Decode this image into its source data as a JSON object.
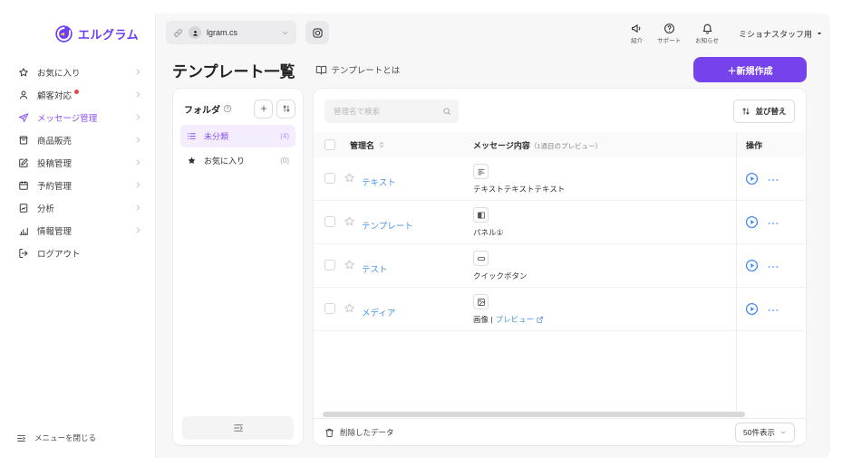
{
  "brand": {
    "logo_text": "エルグラム",
    "brand_color": "#6C3BF5"
  },
  "topbar": {
    "account_value": "lgram.cs",
    "account_icons": [
      "link-icon",
      "avatar-icon",
      "chevron-down-icon"
    ],
    "instagram_icon": "instagram-icon",
    "actions": [
      {
        "label": "紹介",
        "icon": "megaphone"
      },
      {
        "label": "サポート",
        "icon": "help-circle"
      },
      {
        "label": "お知らせ",
        "icon": "bell"
      }
    ],
    "user_menu_label": "ミショナスタッフ用"
  },
  "sidebar": {
    "items": [
      {
        "label": "お気に入り",
        "icon": "star-outline",
        "chevron": true,
        "active": false,
        "dot": false
      },
      {
        "label": "顧客対応",
        "icon": "person",
        "chevron": true,
        "active": false,
        "dot": true
      },
      {
        "label": "メッセージ管理",
        "icon": "send",
        "chevron": true,
        "active": true,
        "dot": false
      },
      {
        "label": "商品販売",
        "icon": "shop",
        "chevron": true,
        "active": false,
        "dot": false
      },
      {
        "label": "投稿管理",
        "icon": "edit",
        "chevron": true,
        "active": false,
        "dot": false
      },
      {
        "label": "予約管理",
        "icon": "calendar",
        "chevron": true,
        "active": false,
        "dot": false
      },
      {
        "label": "分析",
        "icon": "analytics",
        "chevron": true,
        "active": false,
        "dot": false
      },
      {
        "label": "情報管理",
        "icon": "chart",
        "chevron": true,
        "active": false,
        "dot": false
      },
      {
        "label": "ログアウト",
        "icon": "logout",
        "chevron": false,
        "active": false,
        "dot": false
      }
    ],
    "close_menu_label": "メニューを閉じる"
  },
  "page": {
    "title": "テンプレート一覧",
    "help_link": "テンプレートとは",
    "create_button_label": "＋新規作成"
  },
  "folders": {
    "title": "フォルダ",
    "items": [
      {
        "label": "未分類",
        "count": "(4)",
        "icon": "list",
        "active": true
      },
      {
        "label": "お気に入り",
        "count": "(0)",
        "icon": "star-filled",
        "active": false
      }
    ]
  },
  "table": {
    "search_placeholder": "管理名で検索",
    "sort_button_label": "並び替え",
    "columns": {
      "name": "管理名",
      "content": "メッセージ内容",
      "content_note": "（1通目のプレビュー）",
      "actions": "操作"
    },
    "rows": [
      {
        "name": "テキスト",
        "type_icon": "text-lines",
        "content": "テキストテキストテキスト",
        "link": ""
      },
      {
        "name": "テンプレート",
        "type_icon": "panel",
        "content": "パネル①",
        "link": ""
      },
      {
        "name": "テスト",
        "type_icon": "quick-button",
        "content": "クイックボタン",
        "link": ""
      },
      {
        "name": "メディア",
        "type_icon": "image",
        "content": "画像 |",
        "link": "プレビュー"
      }
    ],
    "footer": {
      "deleted_label": "削除したデータ",
      "page_size_label": "50件表示"
    },
    "link_color": "#4d96e8",
    "action_color": "#4285f4"
  }
}
